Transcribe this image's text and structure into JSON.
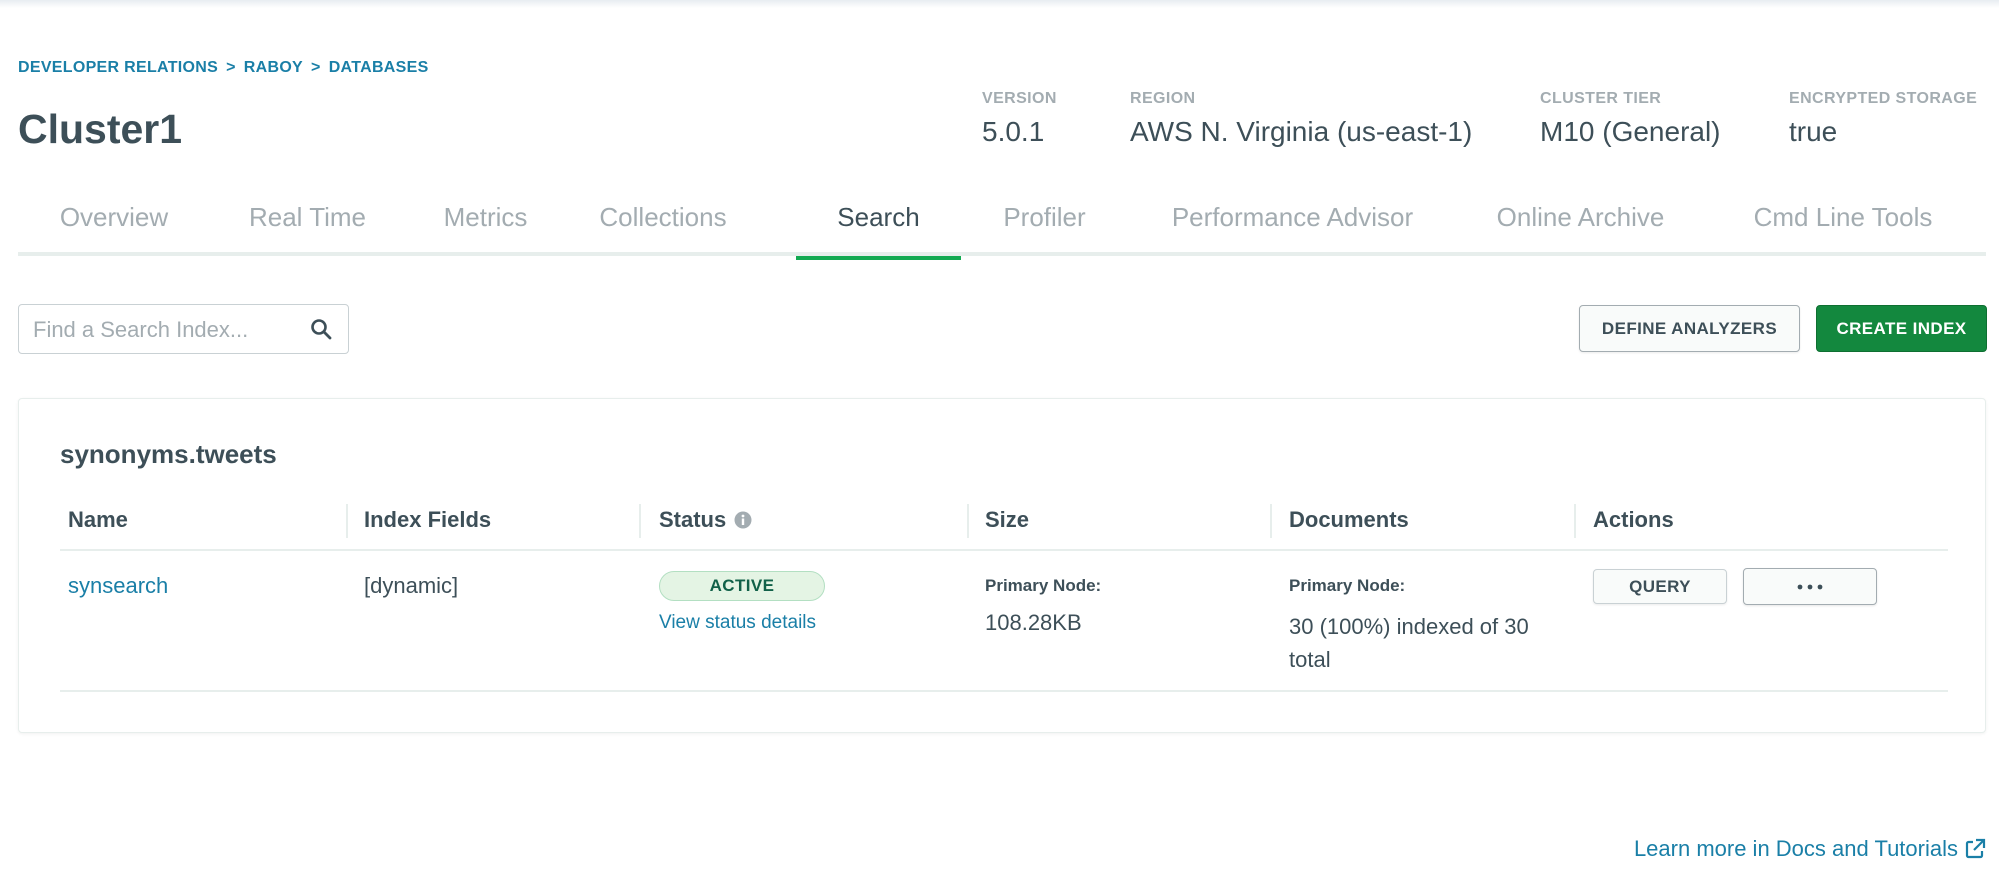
{
  "breadcrumb": [
    "DEVELOPER RELATIONS",
    "RABOY",
    "DATABASES"
  ],
  "breadcrumb_separator": ">",
  "cluster": {
    "name": "Cluster1",
    "meta": [
      {
        "label": "VERSION",
        "value": "5.0.1"
      },
      {
        "label": "REGION",
        "value": "AWS N. Virginia (us-east-1)"
      },
      {
        "label": "CLUSTER TIER",
        "value": "M10 (General)"
      },
      {
        "label": "ENCRYPTED STORAGE",
        "value": "true"
      }
    ]
  },
  "tabs": [
    {
      "label": "Overview",
      "active": false
    },
    {
      "label": "Real Time",
      "active": false
    },
    {
      "label": "Metrics",
      "active": false
    },
    {
      "label": "Collections",
      "active": false
    },
    {
      "label": "Search",
      "active": true
    },
    {
      "label": "Profiler",
      "active": false
    },
    {
      "label": "Performance Advisor",
      "active": false
    },
    {
      "label": "Online Archive",
      "active": false
    },
    {
      "label": "Cmd Line Tools",
      "active": false
    }
  ],
  "search": {
    "placeholder": "Find a Search Index...",
    "value": ""
  },
  "toolbar": {
    "define_label": "DEFINE ANALYZERS",
    "create_label": "CREATE INDEX"
  },
  "index_card": {
    "title": "synonyms.tweets",
    "columns": [
      "Name",
      "Index Fields",
      "Status",
      "Size",
      "Documents",
      "Actions"
    ],
    "rows": [
      {
        "name": "synsearch",
        "fields": "[dynamic]",
        "status": "ACTIVE",
        "status_link": "View status details",
        "size_label": "Primary Node:",
        "size_value": "108.28KB",
        "docs_label": "Primary Node:",
        "docs_value": "30 (100%) indexed of 30 total",
        "query_label": "QUERY"
      }
    ]
  },
  "footer": {
    "learn_more": "Learn more in Docs and Tutorials"
  },
  "colors": {
    "accent": "#13aa52",
    "link": "#1a7fa7",
    "primary_button": "#13883e",
    "text": "#3d4f58",
    "muted": "#a3acb1"
  }
}
